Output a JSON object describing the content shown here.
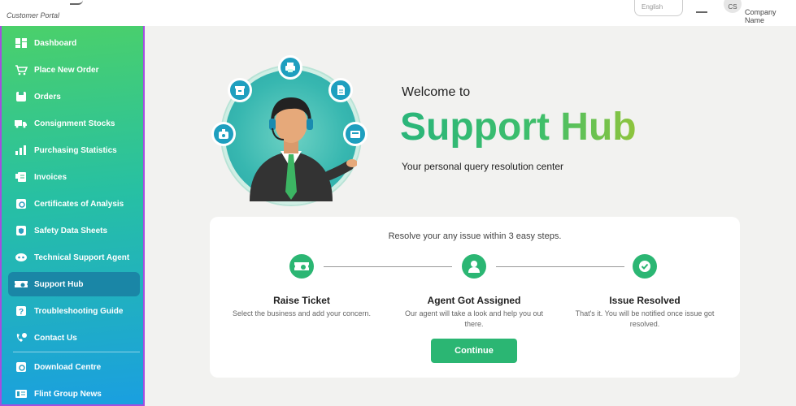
{
  "header": {
    "portal_label": "Customer Portal",
    "language_placeholder": "English",
    "avatar_initials": "CS",
    "company_name": "Company Name"
  },
  "sidebar": {
    "items": [
      {
        "label": "Dashboard",
        "icon": "dashboard-icon"
      },
      {
        "label": "Place New Order",
        "icon": "cart-icon"
      },
      {
        "label": "Orders",
        "icon": "orders-icon"
      },
      {
        "label": "Consignment Stocks",
        "icon": "truck-icon"
      },
      {
        "label": "Purchasing Statistics",
        "icon": "bar-chart-icon"
      },
      {
        "label": "Invoices",
        "icon": "invoice-icon"
      },
      {
        "label": "Certificates of Analysis",
        "icon": "certificate-icon"
      },
      {
        "label": "Safety Data Sheets",
        "icon": "shield-icon"
      },
      {
        "label": "Technical Support Agent",
        "icon": "support-agent-icon"
      },
      {
        "label": "Support Hub",
        "icon": "ticket-icon",
        "active": true
      },
      {
        "label": "Troubleshooting Guide",
        "icon": "question-icon"
      },
      {
        "label": "Contact Us",
        "icon": "phone-icon"
      },
      {
        "label": "Download Centre",
        "icon": "download-icon"
      },
      {
        "label": "Flint Group News",
        "icon": "news-icon"
      }
    ]
  },
  "hero": {
    "welcome": "Welcome to",
    "title": "Support Hub",
    "subtitle": "Your personal query resolution center"
  },
  "steps_card": {
    "title": "Resolve your any issue within 3 easy steps.",
    "steps": [
      {
        "title": "Raise Ticket",
        "description": "Select the business and add your concern."
      },
      {
        "title": "Agent Got Assigned",
        "description": "Our agent will take a look and help you out there."
      },
      {
        "title": "Issue Resolved",
        "description": "That's it. You will be notified once issue got resolved."
      }
    ],
    "continue_label": "Continue"
  },
  "colors": {
    "accent_green": "#2bb673",
    "active_nav": "#1a86a6",
    "sidebar_border": "#a44ee0"
  }
}
